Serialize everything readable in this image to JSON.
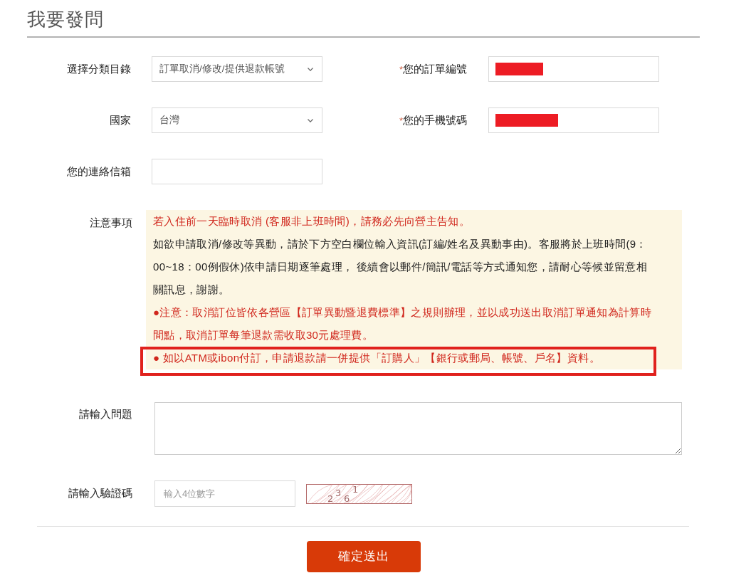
{
  "title": "我要發問",
  "rows": [
    {
      "fields": [
        {
          "kind": "select",
          "label": "選擇分類目錄",
          "value": "訂單取消/修改/提供退款帳號"
        },
        {
          "kind": "text",
          "required_mark": "*",
          "label": "您的訂單編號",
          "redacted": true
        }
      ]
    },
    {
      "fields": [
        {
          "kind": "select",
          "label": "國家",
          "value": "台灣"
        },
        {
          "kind": "text",
          "required_mark": "*",
          "label": "您的手機號碼",
          "redacted": true
        }
      ]
    },
    {
      "fields": [
        {
          "kind": "text",
          "label": "您的連絡信箱",
          "redacted": false
        }
      ]
    }
  ],
  "notice": {
    "label": "注意事項",
    "items": [
      {
        "kind": "warning",
        "text": "若入住前一天臨時取消 (客服非上班時間)，請務必先向營主告知。",
        "highlighted": false
      },
      {
        "kind": "info",
        "text": "如欲申請取消/修改等異動，請於下方空白欄位輸入資訊(訂編/姓名及異動事由)。客服將於上班時間(9：00~18：00例假休)依申請日期逐筆處理， 後續會以郵件/簡訊/電話等方式通知您，請耐心等候並留意相關訊息，謝謝。",
        "highlighted": false
      },
      {
        "kind": "warning",
        "text": "●注意：取消訂位皆依各營區【訂單異動暨退費標準】之規則辦理，並以成功送出取消訂單通知為計算時間點，取消訂單每筆退款需收取30元處理費。",
        "highlighted": false
      },
      {
        "kind": "warning",
        "text": "● 如以ATM或ibon付訂，申請退款請一併提供「訂購人」【銀行或郵局、帳號、戶名】資料。",
        "highlighted": true
      }
    ]
  },
  "question": {
    "label": "請輸入問題"
  },
  "captcha": {
    "label": "請輸入驗證碼",
    "placeholder": "輸入4位數字",
    "code": "2361"
  },
  "submit": "確定送出"
}
